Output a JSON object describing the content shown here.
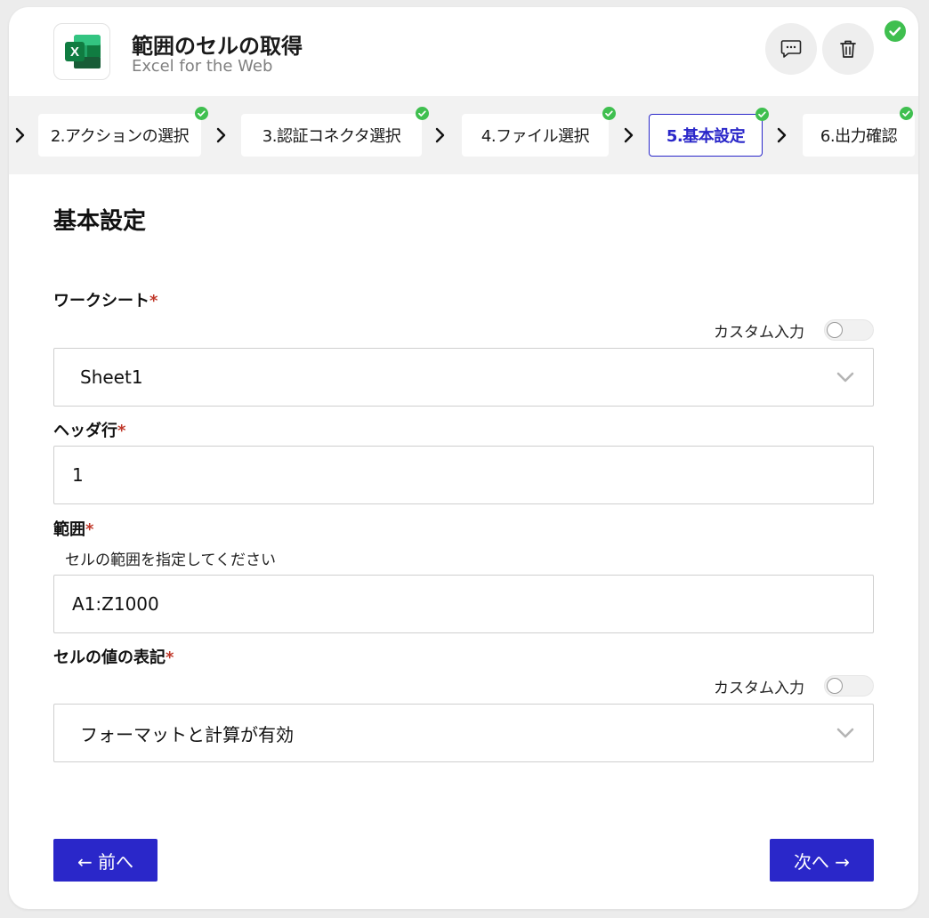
{
  "header": {
    "title": "範囲のセルの取得",
    "subtitle": "Excel for the Web",
    "logo_icon": "excel-logo",
    "comment_icon": "comment-icon",
    "delete_icon": "trash-icon",
    "status_icon": "check-circle-icon"
  },
  "steps": [
    {
      "label": "2.アクションの選択",
      "done": true
    },
    {
      "label": "3.認証コネクタ選択",
      "done": true
    },
    {
      "label": "4.ファイル選択",
      "done": true
    },
    {
      "label": "5.基本設定",
      "done": true,
      "active": true
    },
    {
      "label": "6.出力確認",
      "done": true
    }
  ],
  "form": {
    "title": "基本設定",
    "required_mark": "*",
    "worksheet": {
      "label": "ワークシート",
      "custom_input_label": "カスタム入力",
      "custom_input_on": false,
      "value": "Sheet1"
    },
    "header_row": {
      "label": "ヘッダ行",
      "value": "1"
    },
    "range": {
      "label": "範囲",
      "hint": "セルの範囲を指定してください",
      "value": "A1:Z1000"
    },
    "cell_value_notation": {
      "label": "セルの値の表記",
      "custom_input_label": "カスタム入力",
      "custom_input_on": false,
      "value": "フォーマットと計算が有効"
    }
  },
  "nav": {
    "prev_label": "← 前へ",
    "next_label": "次へ →"
  },
  "colors": {
    "accent": "#2a27c9",
    "success": "#3fbf4f",
    "required": "#c0392b"
  }
}
